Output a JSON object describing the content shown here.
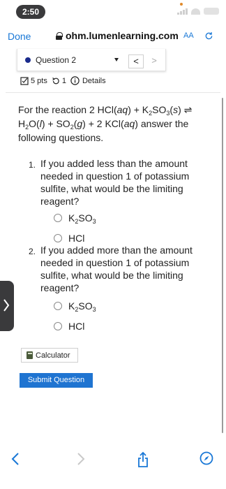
{
  "status_bar": {
    "time": "2:50",
    "accent_color": "#e08a2b"
  },
  "browser": {
    "done_label": "Done",
    "url": "ohm.lumenlearning.com",
    "text_size_label": "AA"
  },
  "question_nav": {
    "selected": "Question 2",
    "prev_label": "<",
    "next_label": ">"
  },
  "meta": {
    "points": "5 pts",
    "attempts": "1",
    "details_label": "Details"
  },
  "prompt": {
    "lead": "For the reaction 2 HCl(",
    "aq1": "aq",
    "mid1": ") + K",
    "sub_k": "2",
    "so": "SO",
    "sub_so": "3",
    "paren_s": "(",
    "s": "s",
    "close_s": ") ⇌",
    "h": "H",
    "sub_h": "2",
    "o": "O(",
    "l": "l",
    "mid2": ") + SO",
    "sub_so2": "2",
    "paren_g": "(",
    "g": "g",
    "mid3": ") + 2 KCl(",
    "aq2": "aq",
    "tail": ") answer the following questions."
  },
  "items": [
    {
      "number": "1.",
      "text": "If you added less than the amount needed in question 1 of potassium sulfite, what would be the limiting reagent?",
      "options": [
        {
          "main": "K",
          "sub1": "2",
          "mid": "SO",
          "sub2": "3"
        },
        {
          "label": "HCl"
        }
      ]
    },
    {
      "number": "2.",
      "text": "If you added more than the amount needed in question 1 of potassium sulfite, what would be the limiting reagent?",
      "options": [
        {
          "main": "K",
          "sub1": "2",
          "mid": "SO",
          "sub2": "3"
        },
        {
          "label": "HCl"
        }
      ]
    }
  ],
  "buttons": {
    "calculator": "Calculator",
    "submit": "Submit Question"
  },
  "colors": {
    "link_blue": "#1877d6",
    "submit_blue": "#1f74d1",
    "question_dot": "#1a2b8c"
  },
  "icons": [
    "lock-icon",
    "reload-icon",
    "checkbox-icon",
    "retry-icon",
    "info-icon",
    "calculator-icon",
    "back-arrow-icon",
    "forward-arrow-icon",
    "share-icon",
    "compass-icon"
  ]
}
